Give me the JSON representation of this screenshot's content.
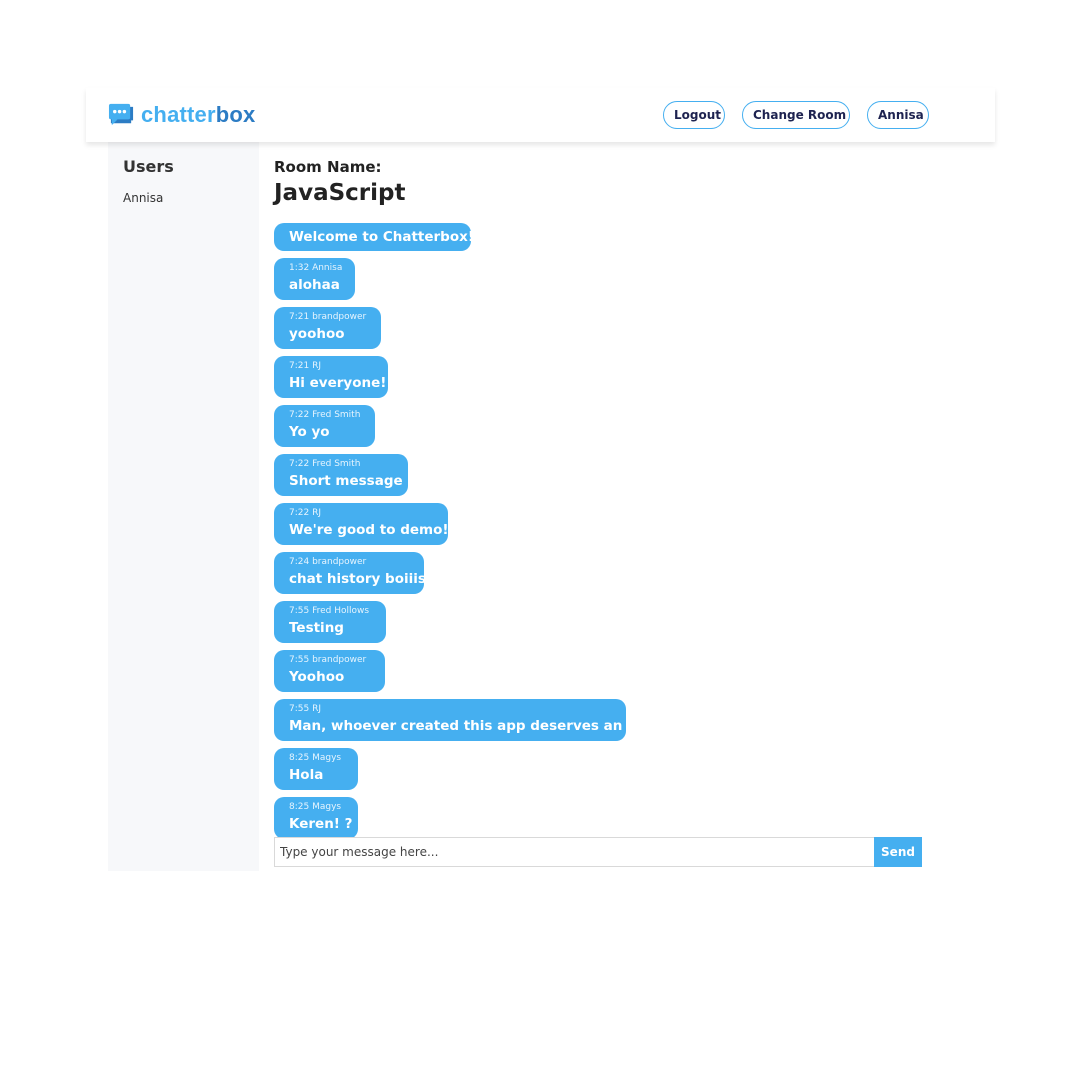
{
  "brand": {
    "name_part1": "chatter",
    "name_part2": "box",
    "logo_icon": "chat-bubble-icon",
    "colors": {
      "light": "#45aff0",
      "dark": "#2c7cc4"
    }
  },
  "nav": {
    "logout_label": "Logout",
    "change_room_label": "Change Room",
    "user_label": "Annisa"
  },
  "sidebar": {
    "title": "Users",
    "users": [
      "Annisa"
    ]
  },
  "room": {
    "label": "Room Name:",
    "name": "JavaScript"
  },
  "messages": [
    {
      "meta": "",
      "text": "Welcome to Chatterbox!"
    },
    {
      "meta": "1:32 Annisa",
      "text": "alohaa"
    },
    {
      "meta": "7:21 brandpower",
      "text": "yoohoo"
    },
    {
      "meta": "7:21 RJ",
      "text": "Hi everyone!"
    },
    {
      "meta": "7:22 Fred Smith",
      "text": "Yo yo"
    },
    {
      "meta": "7:22 Fred Smith",
      "text": "Short message"
    },
    {
      "meta": "7:22 RJ",
      "text": "We're good to demo!"
    },
    {
      "meta": "7:24 brandpower",
      "text": "chat history boiiis"
    },
    {
      "meta": "7:55 Fred Hollows",
      "text": "Testing"
    },
    {
      "meta": "7:55 brandpower",
      "text": "Yoohoo"
    },
    {
      "meta": "7:55 RJ",
      "text": "Man, whoever created this app deserves an A+"
    },
    {
      "meta": "8:25 Magys",
      "text": "Hola"
    },
    {
      "meta": "8:25 Magys",
      "text": "Keren! ?"
    }
  ],
  "composer": {
    "placeholder": "Type your message here...",
    "value": "",
    "send_label": "Send"
  },
  "colors": {
    "accent": "#45aff0",
    "button_text": "#1e2350",
    "sidebar_bg": "#f7f8fa"
  }
}
